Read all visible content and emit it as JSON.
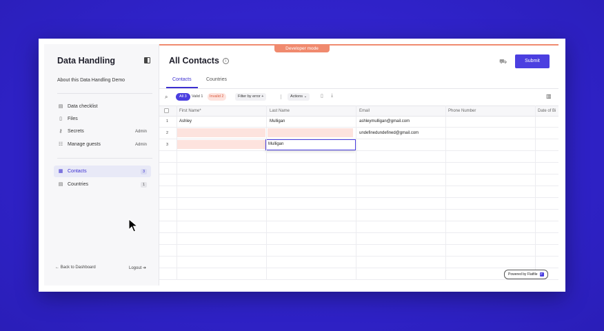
{
  "dev_badge": "Developer mode",
  "sidebar": {
    "brand": "Data Handling",
    "about": "About this Data Handling Demo",
    "items": [
      {
        "label": "Data checklist",
        "icon": "clipboard-icon"
      },
      {
        "label": "Files",
        "icon": "file-icon"
      },
      {
        "label": "Secrets",
        "icon": "key-icon",
        "tag": "Admin"
      },
      {
        "label": "Manage guests",
        "icon": "users-icon",
        "tag": "Admin"
      }
    ],
    "sheets": [
      {
        "label": "Contacts",
        "icon": "chart-icon",
        "count": "3",
        "active": true
      },
      {
        "label": "Countries",
        "icon": "table-icon",
        "count": "1",
        "active": false
      }
    ],
    "back": "← Back to Dashboard",
    "logout": "Logout ➔"
  },
  "header": {
    "title": "All Contacts",
    "submit": "Submit"
  },
  "tabs": [
    "Contacts",
    "Countries"
  ],
  "toolbar": {
    "all": "All 3",
    "valid": "Valid 1",
    "invalid": "Invalid 2",
    "filter": "Filter by error",
    "actions": "Actions"
  },
  "table": {
    "columns": [
      "First Name*",
      "Last Name",
      "Email",
      "Phone Number",
      "Date of Bi"
    ],
    "rows": [
      {
        "n": "1",
        "first": "Ashley",
        "last": "Mulligan",
        "email": "ashleymulligan@gmail.com"
      },
      {
        "n": "2",
        "first": "",
        "last": "",
        "email": "undefinedundefined@gmail.com"
      },
      {
        "n": "3",
        "first": "",
        "last": "Mulligan",
        "email": ""
      }
    ]
  },
  "powered_by": "Powered by Flatfile",
  "colors": {
    "accent": "#4b3fe0",
    "dev_badge": "#f08a6e",
    "error_fill": "#fde3de",
    "background": "#2f22c8"
  }
}
